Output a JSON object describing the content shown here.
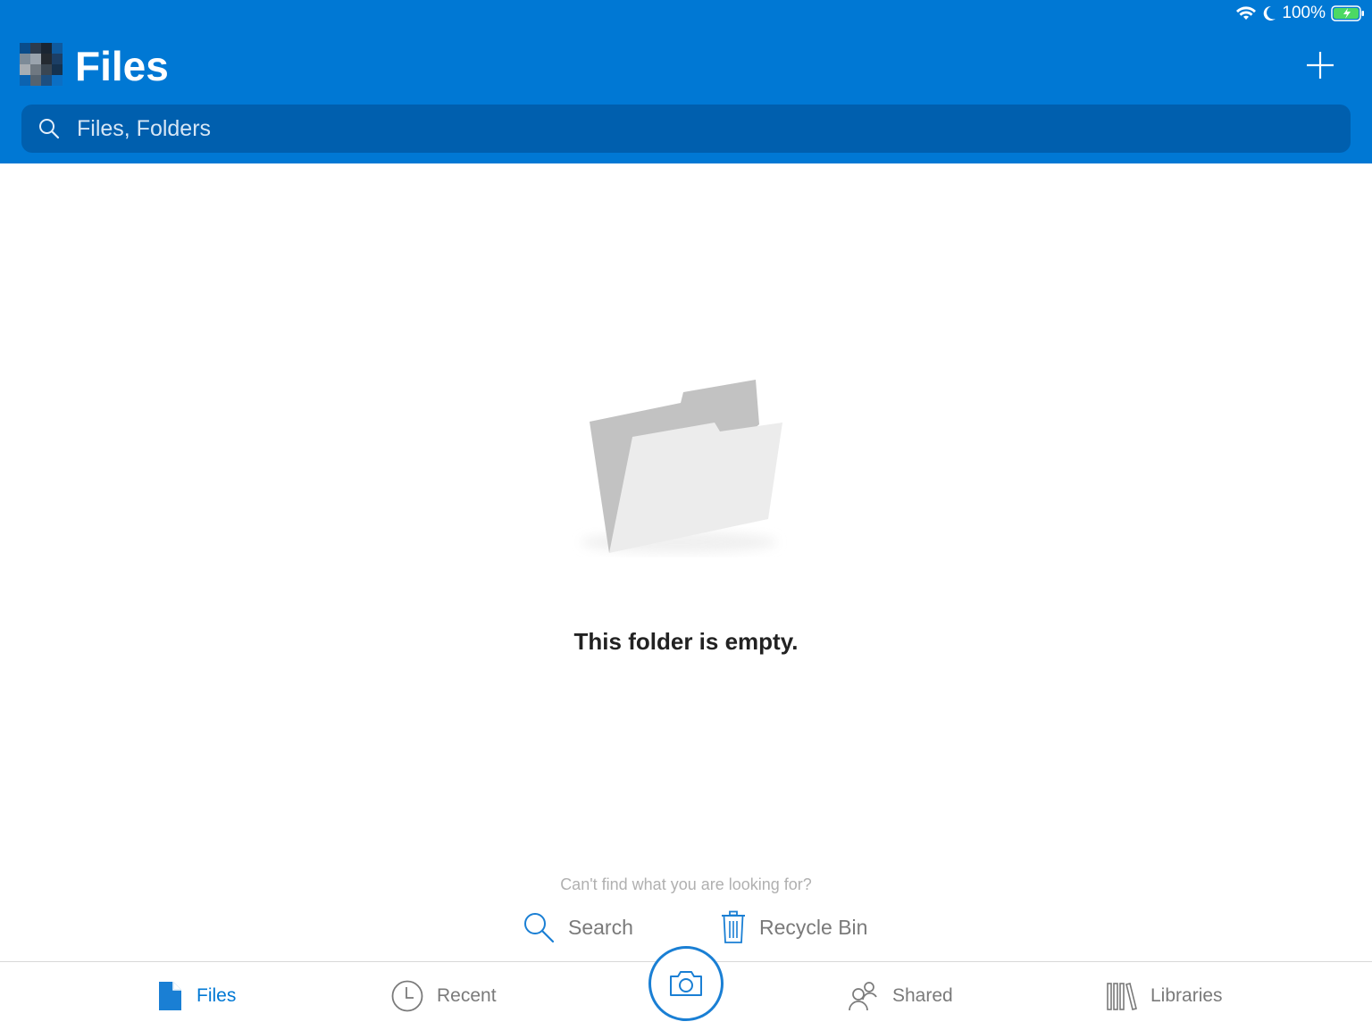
{
  "status_bar": {
    "battery_percent": "100%",
    "icons": [
      "wifi-icon",
      "moon-icon",
      "battery-charging-icon"
    ]
  },
  "header": {
    "title": "Files",
    "add_icon": "plus-icon"
  },
  "search": {
    "placeholder": "Files, Folders",
    "value": "",
    "icon": "search-icon"
  },
  "empty_state": {
    "illustration": "empty-folder-icon",
    "message": "This folder is empty."
  },
  "help": {
    "prompt": "Can't find what you are looking for?",
    "search_label": "Search",
    "recycle_label": "Recycle Bin"
  },
  "tabs": [
    {
      "label": "Files",
      "icon": "file-icon",
      "active": true
    },
    {
      "label": "Recent",
      "icon": "clock-icon",
      "active": false
    },
    {
      "label": "Shared",
      "icon": "people-icon",
      "active": false
    },
    {
      "label": "Libraries",
      "icon": "libraries-icon",
      "active": false
    }
  ],
  "camera": {
    "icon": "camera-icon"
  },
  "colors": {
    "brand": "#0078d4",
    "search_bg": "#005fae",
    "active_tab": "#0078d4",
    "inactive": "#7a7a7a"
  }
}
